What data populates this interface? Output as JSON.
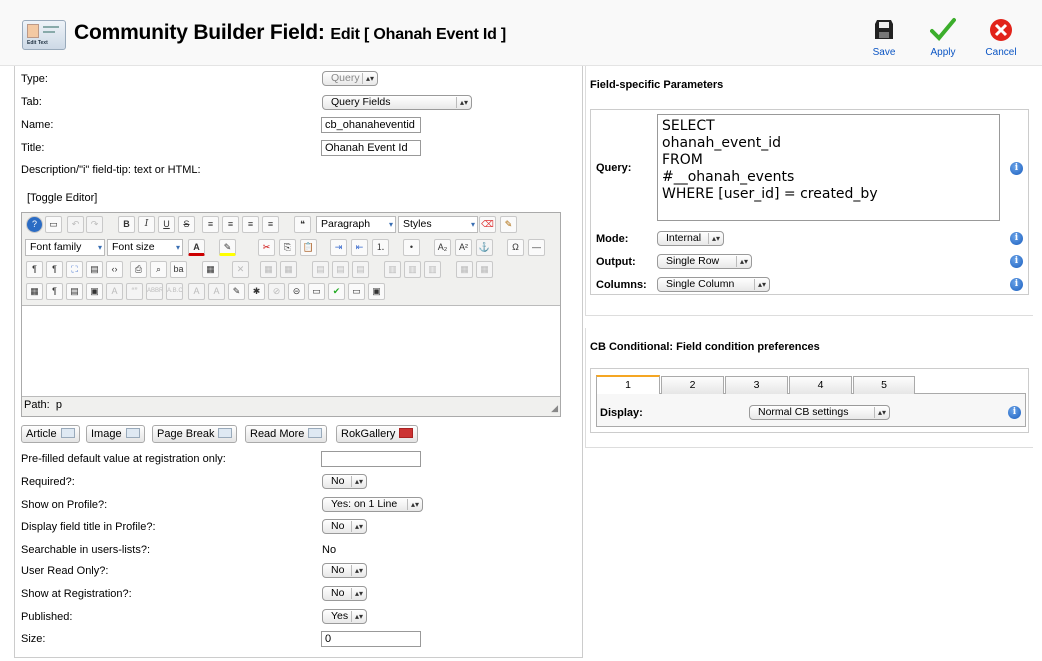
{
  "header": {
    "title": "Community Builder Field:",
    "subtitle": "Edit [ Ohanah Event Id ]",
    "logo_caption": "Edit Text",
    "toolbar": {
      "save": "Save",
      "apply": "Apply",
      "cancel": "Cancel"
    }
  },
  "form": {
    "type_label": "Type:",
    "type_value": "Query",
    "tab_label": "Tab:",
    "tab_value": "Query Fields",
    "name_label": "Name:",
    "name_value": "cb_ohanaheventid",
    "title_label": "Title:",
    "title_value": "Ohanah Event Id",
    "desc_label": "Description/\"i\" field-tip: text or HTML:",
    "toggle_editor": "[Toggle Editor]",
    "prefill_label": "Pre-filled default value at registration only:",
    "prefill_value": "",
    "required_label": "Required?:",
    "required_value": "No",
    "show_profile_label": "Show on Profile?:",
    "show_profile_value": "Yes: on 1 Line",
    "display_title_label": "Display field title in Profile?:",
    "display_title_value": "No",
    "searchable_label": "Searchable in users-lists?:",
    "searchable_value": "No",
    "read_only_label": "User Read Only?:",
    "read_only_value": "No",
    "show_reg_label": "Show at Registration?:",
    "show_reg_value": "No",
    "published_label": "Published:",
    "published_value": "Yes",
    "size_label": "Size:",
    "size_value": "0"
  },
  "editor": {
    "format_value": "Paragraph",
    "styles_value": "Styles",
    "font_family": "Font family",
    "font_size": "Font size",
    "path_label": "Path:",
    "path_value": "p",
    "buttons": {
      "article": "Article",
      "image": "Image",
      "page_break": "Page Break",
      "read_more": "Read More",
      "rokgallery": "RokGallery"
    }
  },
  "params": {
    "heading": "Field-specific Parameters",
    "query_label": "Query:",
    "query_value": "SELECT\nohanah_event_id\nFROM\n#__ohanah_events\nWHERE [user_id] = created_by",
    "mode_label": "Mode:",
    "mode_value": "Internal",
    "output_label": "Output:",
    "output_value": "Single Row",
    "columns_label": "Columns:",
    "columns_value": "Single Column"
  },
  "conditional": {
    "heading": "CB Conditional: Field condition preferences",
    "tabs": [
      "1",
      "2",
      "3",
      "4",
      "5"
    ],
    "display_label": "Display:",
    "display_value": "Normal CB settings"
  },
  "colors": {
    "link": "#0b55c4",
    "tab_accent": "#f5a623",
    "info_icon": "#1b5fbf"
  }
}
